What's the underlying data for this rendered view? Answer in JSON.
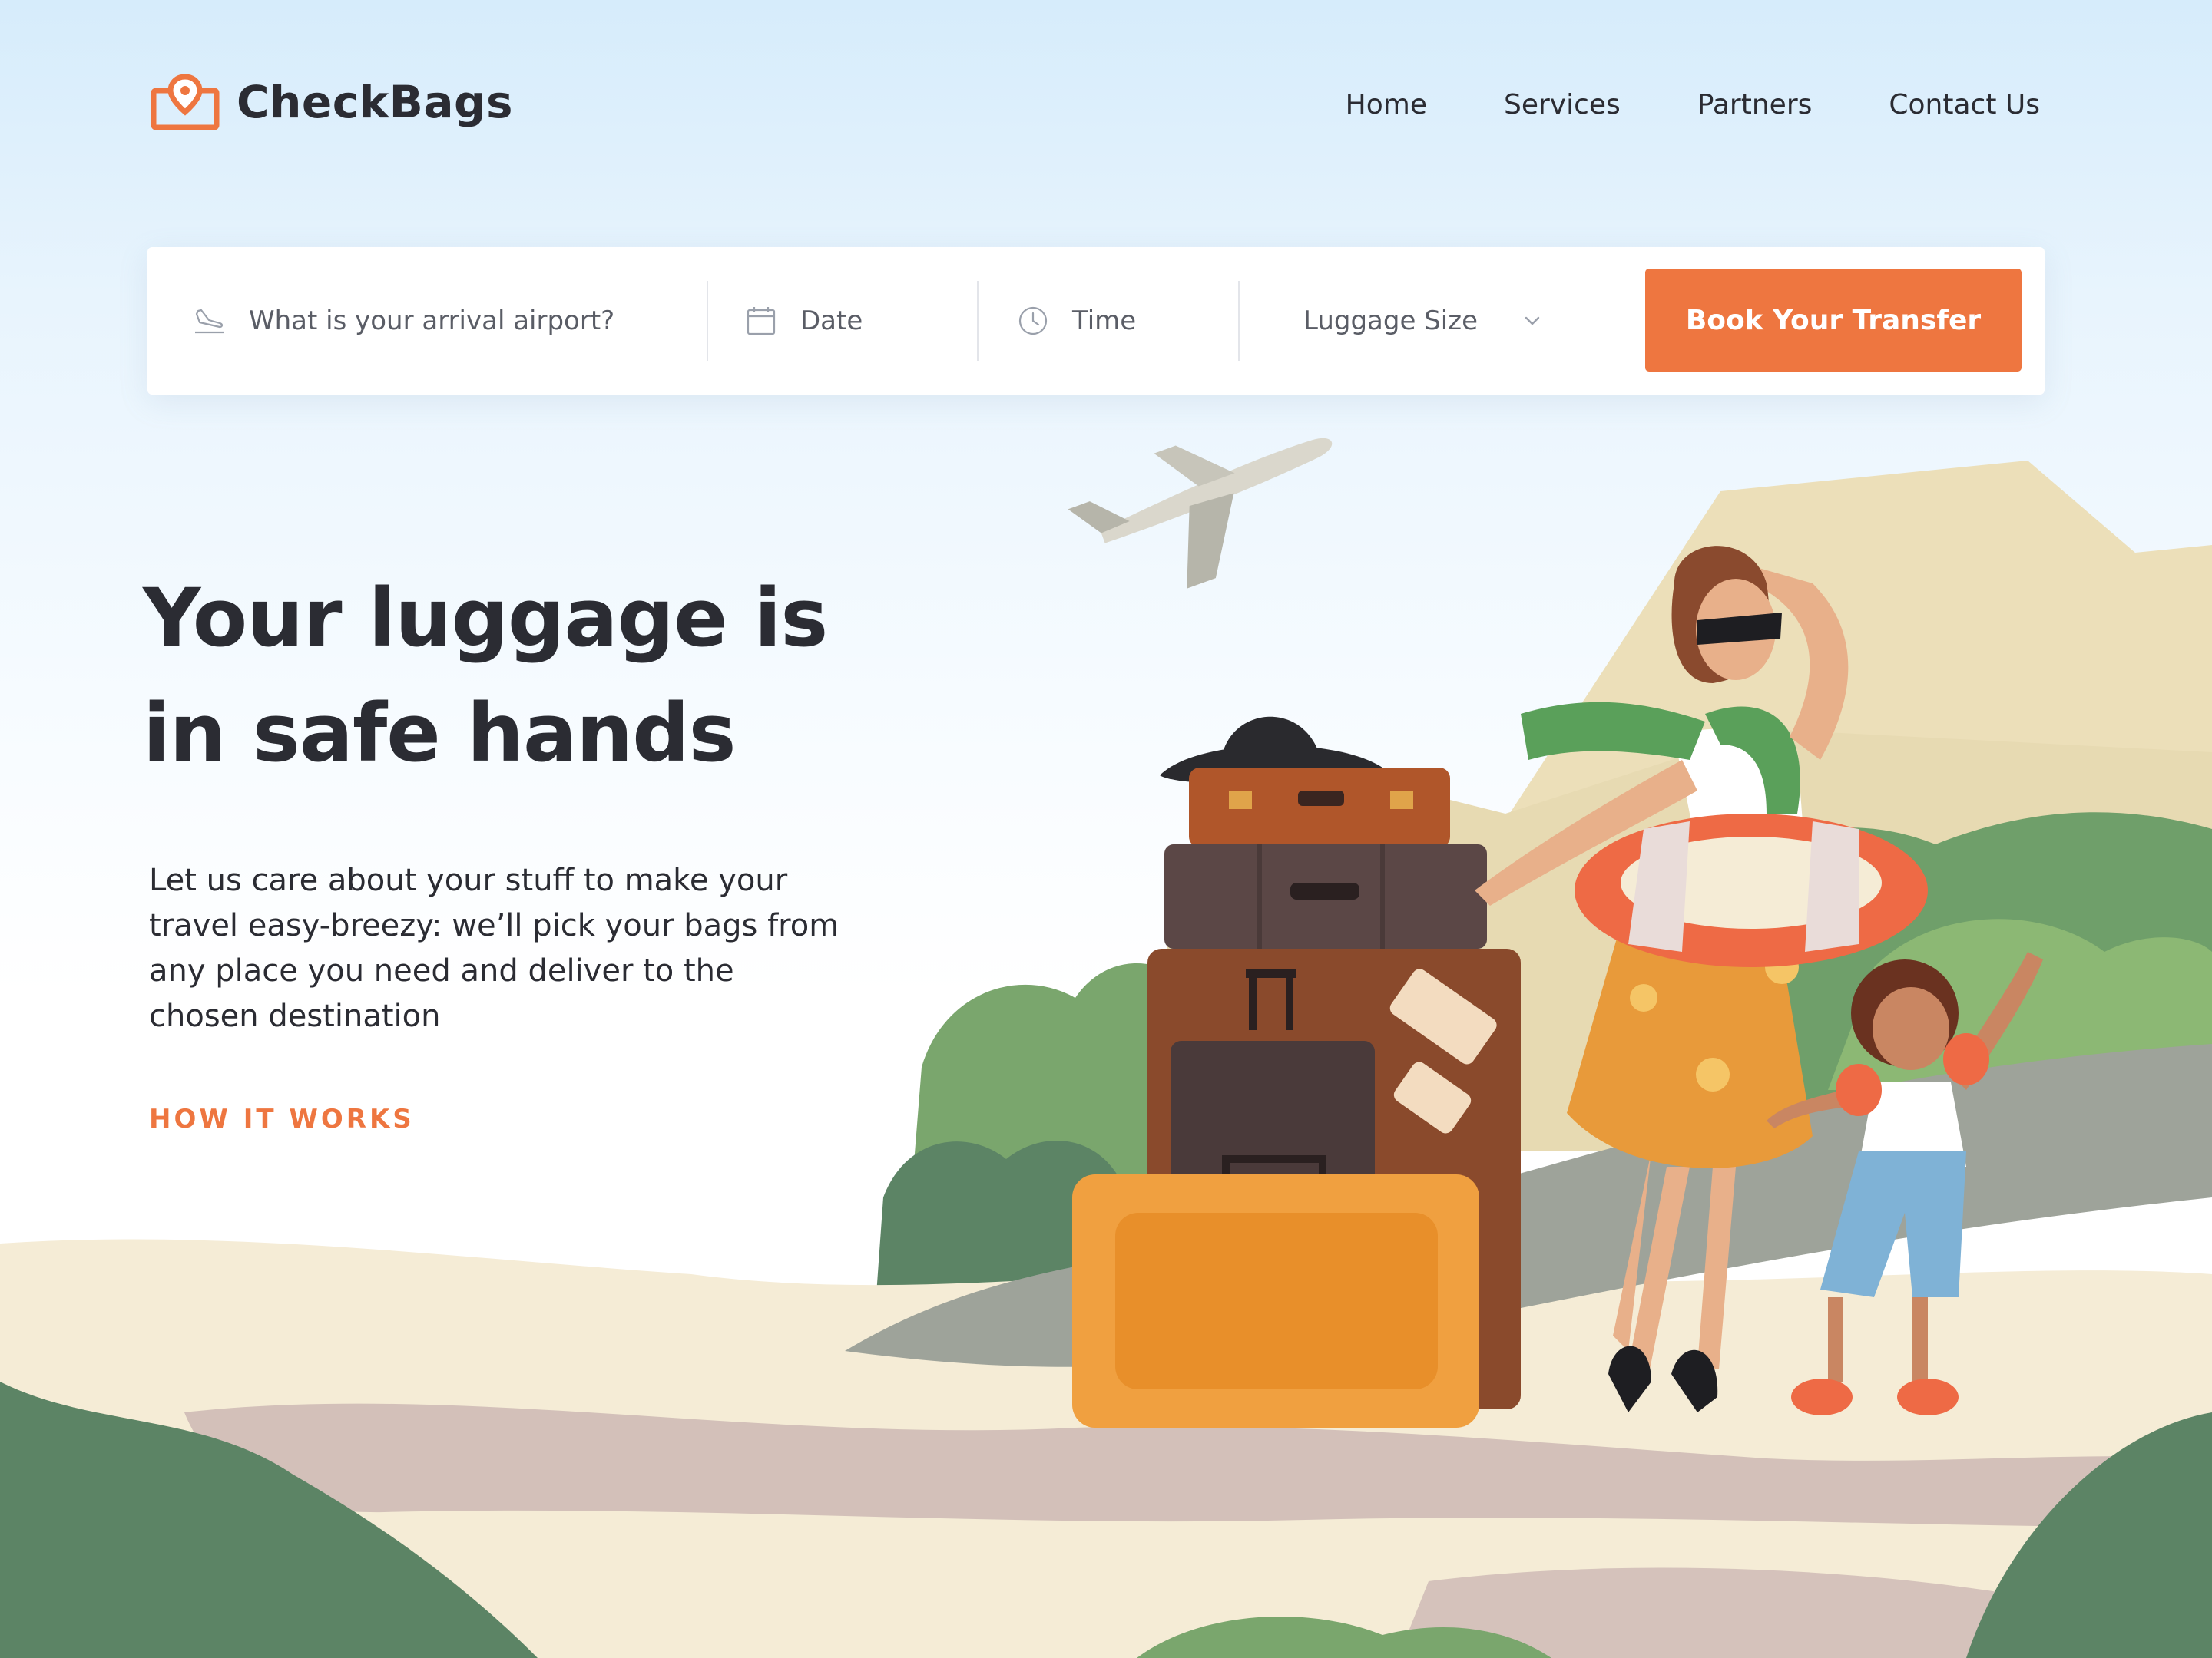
{
  "brand": {
    "name": "CheckBags",
    "accent_color": "#ee7640",
    "logo_icon": "bag-pin-icon"
  },
  "nav": {
    "items": [
      {
        "label": "Home"
      },
      {
        "label": "Services"
      },
      {
        "label": "Partners"
      },
      {
        "label": "Contact Us"
      }
    ]
  },
  "booking": {
    "airport": {
      "icon": "plane-landing-icon",
      "placeholder": "What is your arrival airport?"
    },
    "date": {
      "icon": "calendar-icon",
      "placeholder": "Date"
    },
    "time": {
      "icon": "clock-icon",
      "placeholder": "Time"
    },
    "luggage_size": {
      "icon": "chevron-down-icon",
      "selected": "Luggage Size"
    },
    "submit_label": "Book Your Transfer"
  },
  "hero": {
    "title_line1": "Your luggage is",
    "title_line2": "in safe hands",
    "description": "Let us care about your stuff to make your travel easy-breezy: we’ll pick your bags from any place you need and deliver to the chosen destination",
    "link_label": "HOW IT WORKS"
  },
  "illustration": {
    "colors": {
      "mountain": "#ecdfb9",
      "sand": "#f5ecd6",
      "shadow": "#cdb8b4",
      "foliage": "#7aa66d",
      "foliage_dark": "#5c8465",
      "road": "#9ea39a"
    }
  }
}
